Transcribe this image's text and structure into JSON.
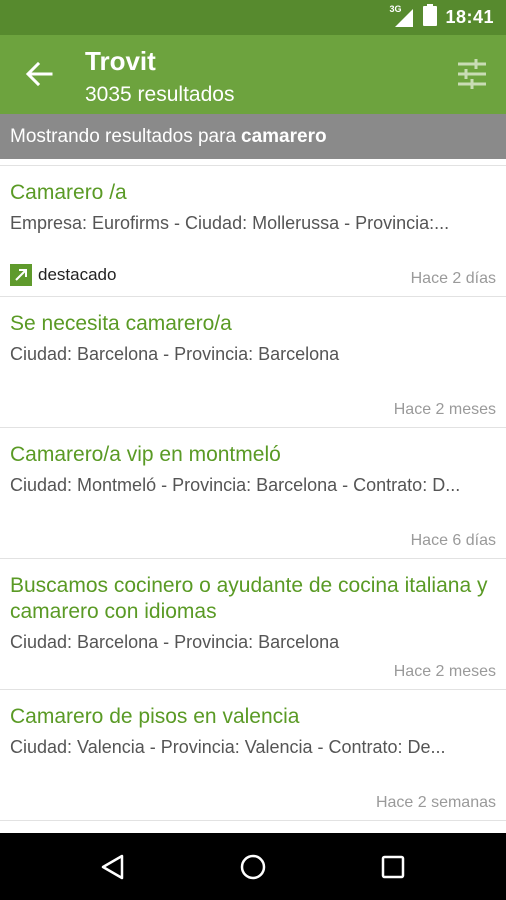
{
  "status_bar": {
    "network": "3G",
    "time": "18:41"
  },
  "app_bar": {
    "title": "Trovit",
    "subtitle": "3035 resultados",
    "back_icon": "arrow-left-icon",
    "filter_icon": "sliders-icon"
  },
  "notice": {
    "prefix": "Mostrando resultados para",
    "query": "camarero"
  },
  "results": [
    {
      "title": "Camarero /a",
      "desc": "Empresa: Eurofirms - Ciudad: Mollerussa - Provincia:...",
      "featured": "destacado",
      "when": "Hace 2 días"
    },
    {
      "title": "Se necesita camarero/a",
      "desc": "Ciudad: Barcelona - Provincia: Barcelona",
      "when": "Hace 2 meses"
    },
    {
      "title": "Camarero/a vip en montmeló",
      "desc": "Ciudad: Montmeló - Provincia: Barcelona - Contrato: D...",
      "when": "Hace 6 días"
    },
    {
      "title": "Buscamos cocinero o ayudante de cocina italiana y camarero con idiomas",
      "desc": "Ciudad: Barcelona - Provincia: Barcelona",
      "when": "Hace 2 meses"
    },
    {
      "title": "Camarero de pisos en valencia",
      "desc": "Ciudad: Valencia - Provincia: Valencia - Contrato: De...",
      "when": "Hace 2 semanas"
    }
  ],
  "colors": {
    "status_bar": "#578a2e",
    "app_bar": "#6da33e",
    "title_green": "#5a9a25",
    "notice_bg": "#8a8a8a"
  }
}
